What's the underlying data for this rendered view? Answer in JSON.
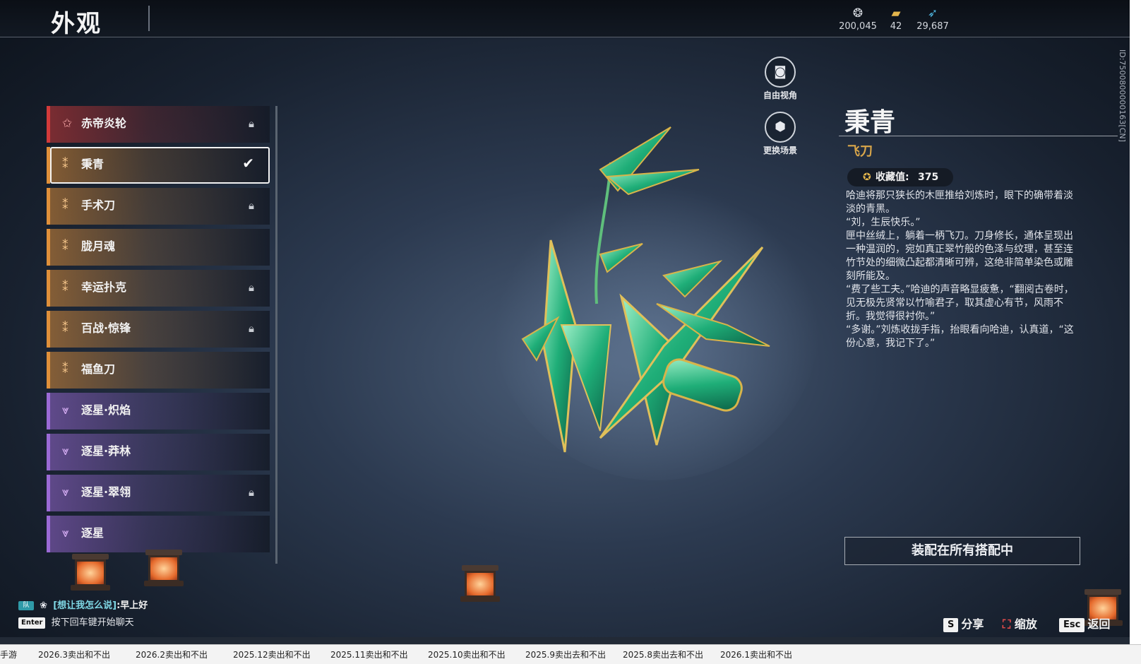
{
  "header": {
    "title": "外观",
    "currencies": [
      {
        "icon": "coin-pouch-icon",
        "value": "200,045"
      },
      {
        "icon": "ticket-icon",
        "value": "42"
      },
      {
        "icon": "feather-icon",
        "value": "29,687"
      }
    ]
  },
  "id_text": "ID:7500800000163[CN]",
  "skins": [
    {
      "label": "赤帝炎轮",
      "rarity": "red",
      "state": "locked"
    },
    {
      "label": "秉青",
      "rarity": "orange",
      "state": "equipped"
    },
    {
      "label": "手术刀",
      "rarity": "orange",
      "state": "locked"
    },
    {
      "label": "胧月魂",
      "rarity": "orange",
      "state": "none"
    },
    {
      "label": "幸运扑克",
      "rarity": "orange",
      "state": "locked"
    },
    {
      "label": "百战·惊锋",
      "rarity": "orange",
      "state": "locked"
    },
    {
      "label": "福鱼刀",
      "rarity": "orange",
      "state": "none"
    },
    {
      "label": "逐星·炽焰",
      "rarity": "purple",
      "state": "none"
    },
    {
      "label": "逐星·莽林",
      "rarity": "purple",
      "state": "none"
    },
    {
      "label": "逐星·翠翎",
      "rarity": "purple",
      "state": "locked"
    },
    {
      "label": "逐星",
      "rarity": "purple",
      "state": "none"
    }
  ],
  "tools": {
    "free_view": "自由视角",
    "change_scene": "更换场景"
  },
  "detail": {
    "name": "秉青",
    "type": "飞刀",
    "collection_label": "收藏值:",
    "collection_value": "375",
    "description": [
      "哈迪将那只狭长的木匣推给刘炼时，眼下的确带着淡淡的青黑。",
      "“刘，生辰快乐。”",
      "匣中丝绒上，躺着一柄飞刀。刀身修长，通体呈现出一种温润的，宛如真正翠竹般的色泽与纹理，甚至连竹节处的细微凸起都清晰可辨，这绝非简单染色或雕刻所能及。",
      "“费了些工夫。”哈迪的声音略显疲惫，“翻阅古卷时，见无极先贤常以竹喻君子，取其虚心有节，风雨不折。我觉得很衬你。”",
      "“多谢。”刘炼收拢手指，抬眼看向哈迪，认真道，“这份心意，我记下了。”"
    ],
    "equip_button": "装配在所有搭配中"
  },
  "chat": {
    "tag": "队",
    "channel": "[想让我怎么说]",
    "message": ":早上好",
    "hint_key": "Enter",
    "hint_text": "按下回车键开始聊天"
  },
  "hotkeys": {
    "share_key": "S",
    "share_label": "分享",
    "zoom_label": "缩放",
    "back_key": "Esc",
    "back_label": "返回"
  },
  "taskbar": {
    "tabs": [
      "手游",
      "2026.3卖出和不出",
      "2026.2卖出和不出",
      "2025.12卖出和不出",
      "2025.11卖出和不出",
      "2025.10卖出和不出",
      "2025.9卖出去和不出",
      "2025.8卖出去和不出",
      "2026.1卖出和不出"
    ]
  },
  "colors": {
    "red": "#d23a3a",
    "orange": "#e0903a",
    "purple": "#9b6ad6",
    "gold": "#d9a64a"
  }
}
